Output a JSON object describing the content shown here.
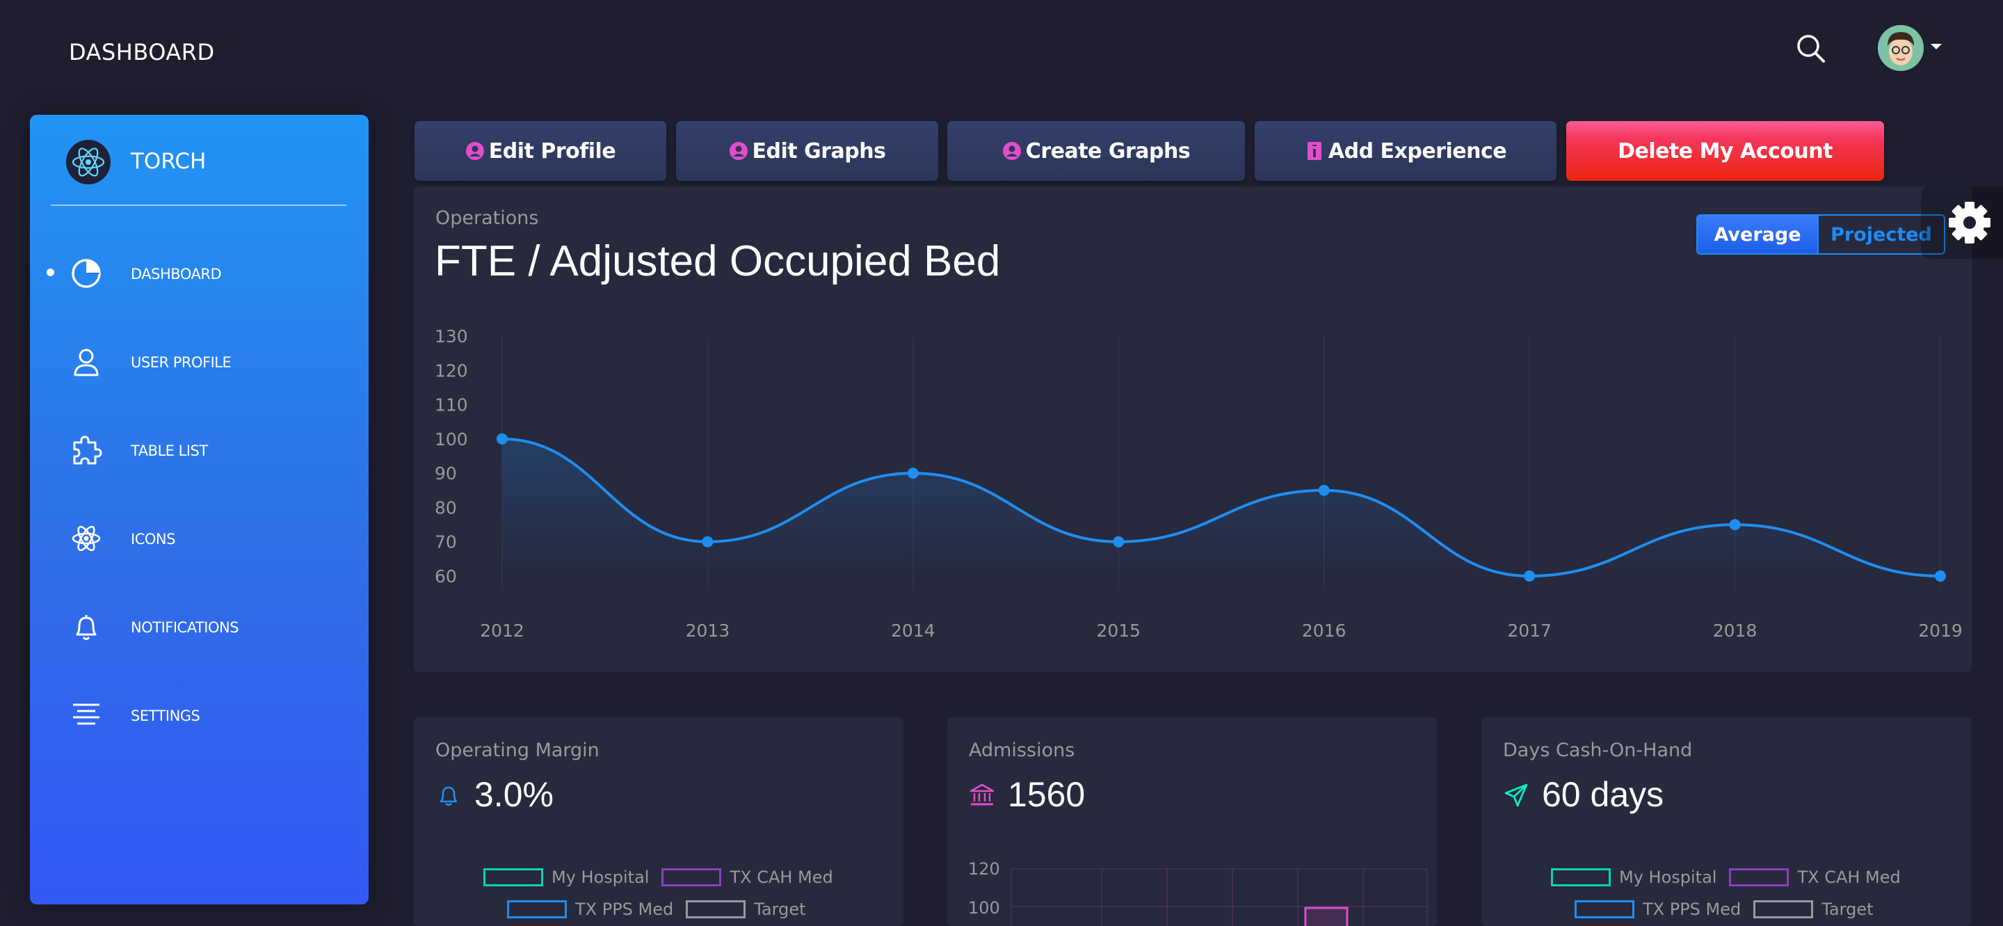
{
  "topbar": {
    "brand": "DASHBOARD",
    "search_icon": "search-icon",
    "avatar_icon": "avatar"
  },
  "sidebar": {
    "brand": "TORCH",
    "items": [
      {
        "label": "DASHBOARD",
        "icon": "pie-chart-icon",
        "active": true
      },
      {
        "label": "USER PROFILE",
        "icon": "user-icon",
        "active": false
      },
      {
        "label": "TABLE LIST",
        "icon": "puzzle-icon",
        "active": false
      },
      {
        "label": "ICONS",
        "icon": "atom-icon",
        "active": false
      },
      {
        "label": "NOTIFICATIONS",
        "icon": "bell-icon",
        "active": false
      },
      {
        "label": "SETTINGS",
        "icon": "align-center-icon",
        "active": false
      }
    ]
  },
  "actions": {
    "edit_profile": "Edit Profile",
    "edit_graphs": "Edit Graphs",
    "create_graphs": "Create Graphs",
    "add_experience": "Add Experience",
    "delete_account": "Delete My Account"
  },
  "main_card": {
    "category": "Operations",
    "title": "FTE / Adjusted Occupied Bed",
    "toggle_average": "Average",
    "toggle_projected": "Projected"
  },
  "chart_data": {
    "type": "line",
    "title": "FTE / Adjusted Occupied Bed",
    "x": [
      "2012",
      "2013",
      "2014",
      "2015",
      "2016",
      "2017",
      "2018",
      "2019"
    ],
    "series": [
      {
        "values": [
          100,
          70,
          90,
          70,
          85,
          60,
          75,
          60
        ]
      }
    ],
    "yticks": [
      60,
      70,
      80,
      90,
      100,
      110,
      120,
      130
    ],
    "ylim": [
      60,
      130
    ],
    "xlabel": "",
    "ylabel": "",
    "grid": "vertical",
    "color": "#1f8ef1"
  },
  "cards": [
    {
      "category": "Operating Margin",
      "value": "3.0%",
      "icon": "bell-icon",
      "icon_color": "#1f8ef1",
      "legend": [
        "My Hospital",
        "TX CAH Med",
        "TX PPS Med",
        "Target"
      ]
    },
    {
      "category": "Admissions",
      "value": "1560",
      "icon": "bank-icon",
      "icon_color": "#e14eca",
      "yticks": [
        "120",
        "100"
      ]
    },
    {
      "category": "Days Cash-On-Hand",
      "value": "60 days",
      "icon": "send-icon",
      "icon_color": "#00f2c3",
      "legend": [
        "My Hospital",
        "TX CAH Med",
        "TX PPS Med",
        "Target"
      ]
    }
  ],
  "colors": {
    "background": "#1e1e2f",
    "card": "#27293d",
    "primary": "#1d8cf8",
    "danger": "#f5365c",
    "legend_my_hospital": "#00d6b4",
    "legend_cah": "#8a3fbf",
    "legend_pps": "#1f8ef1",
    "legend_target": "#9a9a9a"
  }
}
